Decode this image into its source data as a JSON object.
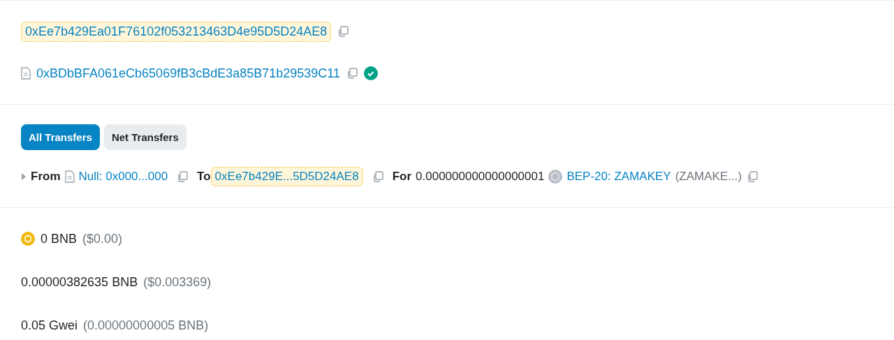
{
  "from_address": {
    "text": "0xEe7b429Ea01F76102f053213463D4e95D5D24AE8",
    "highlighted": true
  },
  "to_address": {
    "text": "0xBDbBFA061eCb65069fB3cBdE3a85B71b29539C11",
    "verified": true
  },
  "tabs": [
    {
      "label": "All Transfers",
      "selected": true
    },
    {
      "label": "Net Transfers",
      "selected": false
    }
  ],
  "transfer": {
    "from_label": "From",
    "from": "Null: 0x000...000",
    "to_label": "To",
    "to": "0xEe7b429E...5D5D24AE8",
    "to_highlighted": true,
    "for_label": "For",
    "amount": "0.000000000000000001",
    "token": "BEP-20: ZAMAKEY",
    "token_symbol": "(ZAMAKE...)"
  },
  "value": {
    "amount": "0 BNB",
    "usd": "($0.00)"
  },
  "fee": {
    "amount": "0.00000382635 BNB",
    "usd": "($0.003369)"
  },
  "gas_price": {
    "amount": "0.05 Gwei",
    "bnb": "(0.00000000005 BNB)"
  }
}
